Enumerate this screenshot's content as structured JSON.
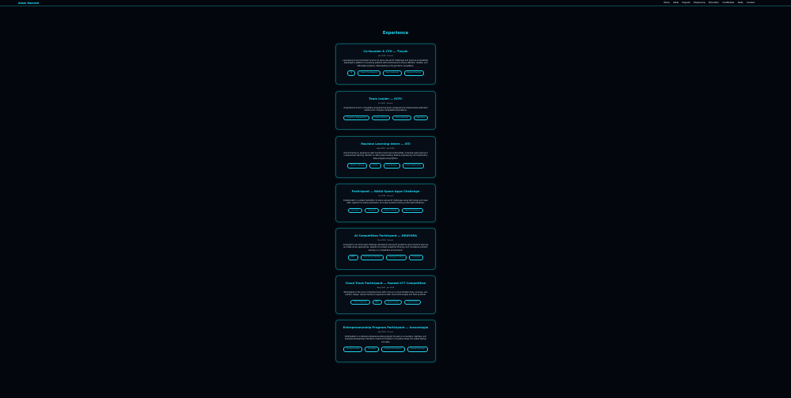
{
  "header": {
    "brand": "Adam Hameed",
    "nav": [
      "Home",
      "Skills",
      "Projects",
      "Experience",
      "Education",
      "Certificates",
      "Skills",
      "Contact"
    ]
  },
  "experience": {
    "title": "Experience",
    "items": [
      {
        "title": "Co-founder & CTO — Tinyah",
        "date": "Jan 2024",
        "type": "Present",
        "description": "Leveraging AI and Computer Science to solve real-world challenges and improve accessibility. Developed a platform connecting patients with pharmacies to ensure efficient, reliable, and affordable solutions. Participating in the Jadi Tech competition.",
        "tags": [
          "AI",
          "Product Development",
          "Team Leadership",
          "Business Planning"
        ]
      },
      {
        "title": "Team Leader — ECPC",
        "date": "Jul 2024",
        "type": "Present",
        "description": "Organized and led a competitive programming team. Designed and implemented optimized solutions for complex computational problems.",
        "tags": [
          "Competitive Programming",
          "Problem Solving",
          "Team Leadership",
          "Algorithms"
        ]
      },
      {
        "title": "Machine Learning Intern — NTI",
        "date": "Aug 2024",
        "type": "Sep 2024",
        "description": "Gained hands-on experience with machine learning fundamentals, including supervised and unsupervised learning. Worked on data preprocessing, feature engineering, and exploratory data analysis using Python.",
        "tags": [
          "Machine Learning",
          "Python",
          "Data Analysis",
          "Feature Engineering"
        ]
      },
      {
        "title": "Participant — NASA Space Apps Challenge",
        "date": "Oct 2024",
        "type": "Present",
        "description": "Collaborated in a global hackathon to solve real-world challenges using technology and open data. Applied innovative teamwork, and rapid problem-solving under tight deadlines.",
        "tags": [
          "Innovation",
          "Teamwork",
          "Problem Solving",
          "Rapid Development"
        ]
      },
      {
        "title": "AI Competition Participant — DRAYORA",
        "date": "Nov 2024",
        "type": "Present",
        "description": "Competed in an AI-focused challenge addressing real-world problems using machine learning and data-driven approaches. Applied AI models, analytical thinking, and innovative problem-solving in a competitive environment.",
        "tags": [
          "AI/ML",
          "Data Science Solutions",
          "Analytical Thinking",
          "Innovation"
        ]
      },
      {
        "title": "Cloud Track Participant — Huawei ICT Competition",
        "date": "Aug 2024",
        "type": "Jan 2024",
        "description": "Participated in the cloud computing track with a focus on cloud infrastructure, services, and solution design. Gained hands-on experience with cloud technologies and their practical.",
        "tags": [
          "Cloud Computing",
          "AWS",
          "System Design",
          "Infrastructure"
        ]
      },
      {
        "title": "Entrepreneurship Program Participant — Innovelogia",
        "date": "Sep 2024",
        "type": "Present",
        "description": "Participated in a national entrepreneurship program focused on innovation, startups, and business development. Worked in teams to transform innovative ideas into viable startup concepts.",
        "tags": [
          "Entrepreneurship",
          "Innovation",
          "Business Development",
          "Startup Operations"
        ]
      }
    ]
  }
}
